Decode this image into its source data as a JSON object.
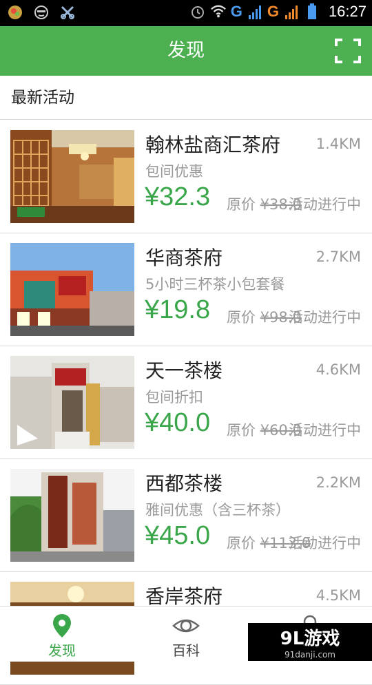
{
  "statusbar": {
    "left_icons": [
      "game-icon",
      "face-icon",
      "tools-icon"
    ],
    "network_label_1": "G",
    "network_label_2": "G",
    "time": "16:27"
  },
  "header": {
    "title": "发现",
    "scan_icon": "scan-icon"
  },
  "section": {
    "title": "最新活动"
  },
  "items": [
    {
      "name": "翰林盐商汇茶府",
      "distance": "1.4KM",
      "subtitle": "包间优惠",
      "price": "¥32.3",
      "original_label": "原价",
      "original_price": "¥38.0",
      "status": "活动进行中"
    },
    {
      "name": "华商茶府",
      "distance": "2.7KM",
      "subtitle": "5小时三杯茶小包套餐",
      "price": "¥19.8",
      "original_label": "原价",
      "original_price": "¥98.0",
      "status": "活动进行中"
    },
    {
      "name": "天一茶楼",
      "distance": "4.6KM",
      "subtitle": "包间折扣",
      "price": "¥40.0",
      "original_label": "原价",
      "original_price": "¥60.0",
      "status": "活动进行中"
    },
    {
      "name": "西都茶楼",
      "distance": "2.2KM",
      "subtitle": "雅间优惠（含三杯茶）",
      "price": "¥45.0",
      "original_label": "原价",
      "original_price": "¥113.0",
      "status": "活动进行中"
    },
    {
      "name": "香岸茶府",
      "distance": "4.5KM"
    }
  ],
  "bottomnav": {
    "tabs": [
      {
        "label": "发现",
        "icon": "location-pin-icon",
        "active": true
      },
      {
        "label": "百科",
        "icon": "eye-icon",
        "active": false
      }
    ]
  },
  "watermark": {
    "brand": "9L游戏",
    "url": "91danji.com"
  },
  "colors": {
    "accent": "#4caf50",
    "price": "#3aa64a",
    "muted": "#9a9a9a"
  }
}
